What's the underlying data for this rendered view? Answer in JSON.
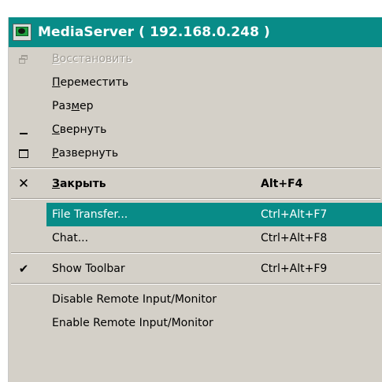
{
  "window": {
    "title": "MediaServer ( 192.168.0.248 )"
  },
  "menu": {
    "items": [
      {
        "label": "Восстановить",
        "accel": "В",
        "shortcut": "",
        "icon": "restore-icon",
        "disabled": true
      },
      {
        "label": "Переместить",
        "accel": "П",
        "shortcut": "",
        "icon": "",
        "disabled": false
      },
      {
        "label": "Размер",
        "accel": "м",
        "shortcut": "",
        "icon": "",
        "disabled": false
      },
      {
        "label": "Свернуть",
        "accel": "С",
        "shortcut": "",
        "icon": "minimize-icon",
        "disabled": false
      },
      {
        "label": "Развернуть",
        "accel": "Р",
        "shortcut": "",
        "icon": "maximize-icon",
        "disabled": false
      },
      {
        "label": "Закрыть",
        "accel": "З",
        "shortcut": "Alt+F4",
        "icon": "close-icon",
        "disabled": false
      },
      {
        "label": "File Transfer...",
        "shortcut": "Ctrl+Alt+F7",
        "icon": "",
        "highlighted": true
      },
      {
        "label": "Chat...",
        "shortcut": "Ctrl+Alt+F8",
        "icon": ""
      },
      {
        "label": "Show Toolbar",
        "shortcut": "Ctrl+Alt+F9",
        "icon": "check-icon",
        "checked": true
      },
      {
        "label": "Disable Remote Input/Monitor",
        "shortcut": "",
        "icon": ""
      },
      {
        "label": "Enable Remote Input/Monitor",
        "shortcut": "",
        "icon": ""
      }
    ]
  },
  "colors": {
    "titlebar": "#088c88",
    "highlight": "#088c88",
    "menu_bg": "#d4d0c8",
    "disabled_text": "#a09c94"
  },
  "icons": {
    "close_glyph": "✕",
    "check_glyph": "✔"
  }
}
